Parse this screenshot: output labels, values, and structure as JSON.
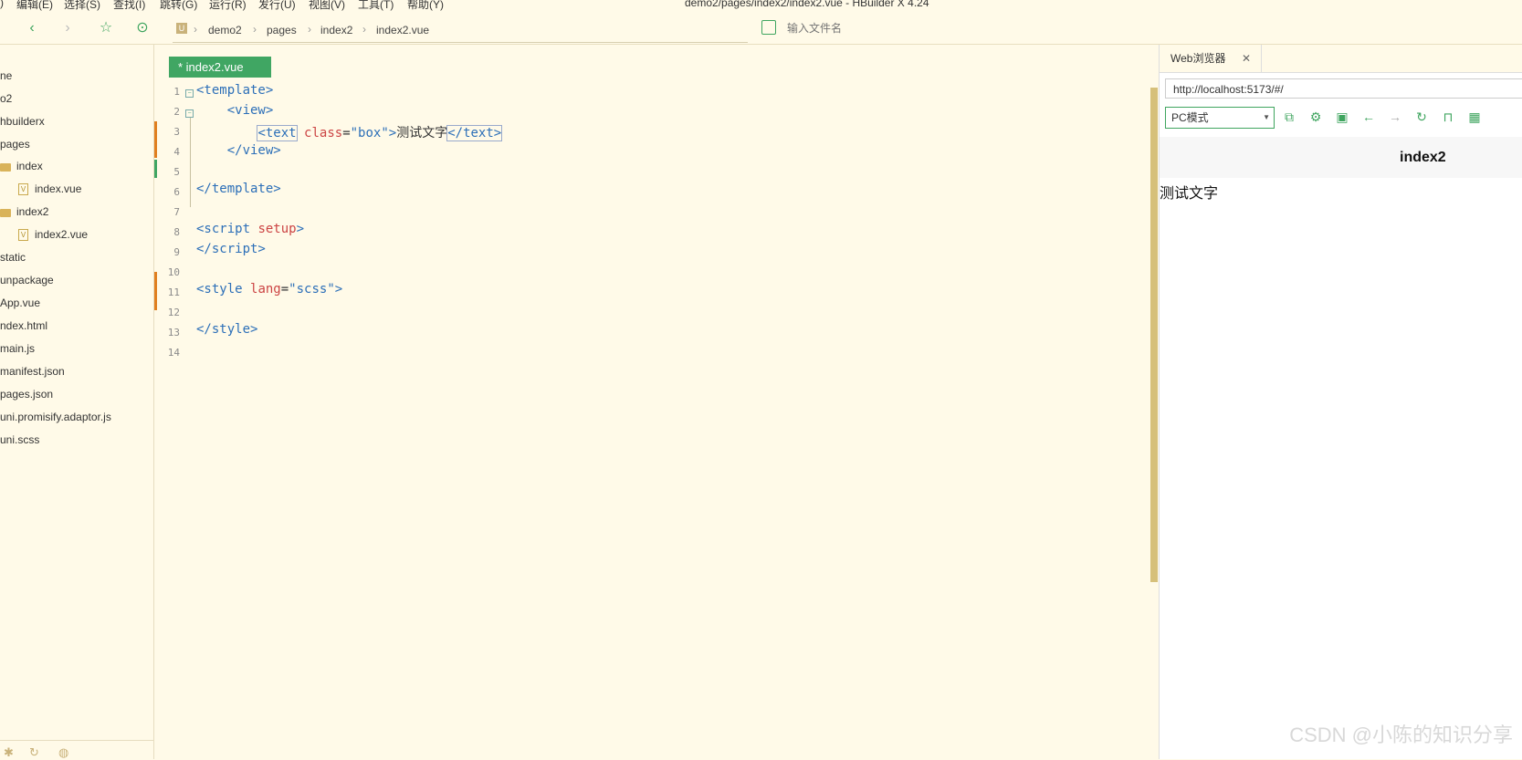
{
  "window": {
    "title": "demo2/pages/index2/index2.vue - HBuilder X 4.24"
  },
  "menu": {
    "items": [
      "编辑(E)",
      "选择(S)",
      "查找(I)",
      "跳转(G)",
      "运行(R)",
      "发行(U)",
      "视图(V)",
      "工具(T)",
      "帮助(Y)"
    ]
  },
  "toolbar": {
    "back_icon": "chevron-left-icon",
    "forward_icon": "chevron-right-icon",
    "favorite_icon": "star-icon",
    "run_icon": "play-circle-icon",
    "breadcrumbs": [
      "demo2",
      "pages",
      "index2",
      "index2.vue"
    ],
    "search_placeholder": "输入文件名"
  },
  "sidebar": {
    "items": [
      {
        "label": "ne",
        "type": "folder"
      },
      {
        "label": "o2",
        "type": "folder"
      },
      {
        "label": "hbuilderx",
        "type": "folder"
      },
      {
        "label": "pages",
        "type": "folder"
      },
      {
        "label": "index",
        "type": "folder"
      },
      {
        "label": "index.vue",
        "type": "file"
      },
      {
        "label": "index2",
        "type": "folder"
      },
      {
        "label": "index2.vue",
        "type": "file"
      },
      {
        "label": "static",
        "type": "folder"
      },
      {
        "label": "unpackage",
        "type": "folder"
      },
      {
        "label": "App.vue",
        "type": "file"
      },
      {
        "label": "ndex.html",
        "type": "file"
      },
      {
        "label": "main.js",
        "type": "file"
      },
      {
        "label": "manifest.json",
        "type": "file"
      },
      {
        "label": "pages.json",
        "type": "file"
      },
      {
        "label": "uni.promisify.adaptor.js",
        "type": "file"
      },
      {
        "label": "uni.scss",
        "type": "file"
      }
    ]
  },
  "editor": {
    "tab_label": "* index2.vue",
    "line_numbers": [
      "1",
      "2",
      "3",
      "4",
      "5",
      "6",
      "7",
      "8",
      "9",
      "10",
      "11",
      "12",
      "13",
      "14"
    ]
  },
  "browser": {
    "tab_label": "Web浏览器",
    "url": "http://localhost:5173/#/",
    "device_mode": "PC模式",
    "page_title": "index2",
    "page_text": "测试文字"
  },
  "watermark": "CSDN @小陈的知识分享",
  "colors": {
    "accent": "#40a663",
    "background": "#fffae8",
    "tag": "#2c6fb8",
    "attr": "#cc4444"
  }
}
